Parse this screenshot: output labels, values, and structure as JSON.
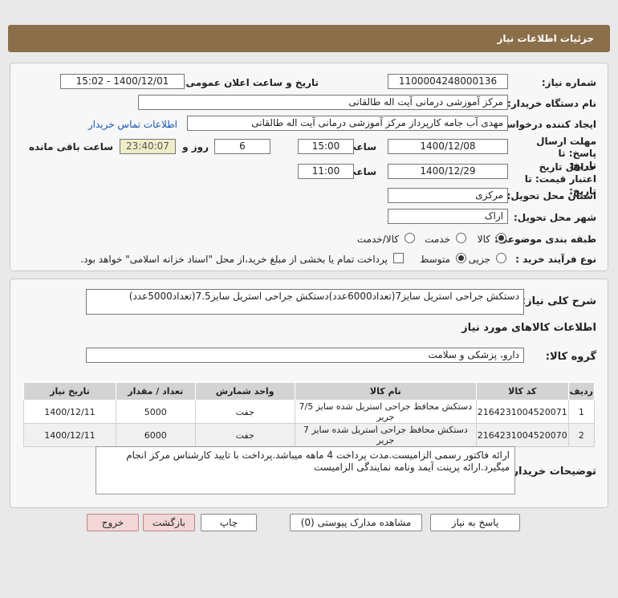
{
  "header": {
    "title": "جزئیات اطلاعات نیاز"
  },
  "form": {
    "need_number": {
      "label": "شماره نیاز:",
      "value": "1100004248000136"
    },
    "announce_datetime": {
      "label": "تاریخ و ساعت اعلان عمومی:",
      "value": "1400/12/01 - 15:02"
    },
    "buyer_org": {
      "label": "نام دستگاه خریدار:",
      "value": "مرکز آموزشی  درمانی آیت اله طالقانی"
    },
    "creator": {
      "label": "ایجاد کننده درخواست:",
      "value": "مهدی آب جامه کارپرداز مرکز آموزشی  درمانی آیت اله طالقانی",
      "contact_link": "اطلاعات تماس خریدار"
    },
    "send_deadline": {
      "label": "مهلت ارسال پاسخ: تا تاریخ:",
      "date": "1400/12/08",
      "time_label": "ساعت",
      "time": "15:00",
      "days": "6",
      "days_label": "روز و",
      "remaining": "23:40:07",
      "remaining_label": "ساعت باقی مانده"
    },
    "price_validity": {
      "label": "حداقل تاریخ اعتبار قیمت: تا تاریخ:",
      "date": "1400/12/29",
      "time_label": "ساعت",
      "time": "11:00"
    },
    "delivery_province": {
      "label": "استان محل تحویل:",
      "value": "مرکزی"
    },
    "delivery_city": {
      "label": "شهر محل تحویل:",
      "value": "اراک"
    },
    "category": {
      "label": "طبقه بندی موضوعی:",
      "options": [
        "کالا",
        "خدمت",
        "کالا/خدمت"
      ],
      "selected": "کالا"
    },
    "purchase_process": {
      "label": "نوع فرآیند خرید :",
      "options": [
        "جزیی",
        "متوسط"
      ],
      "selected": "متوسط",
      "note": "پرداخت تمام یا بخشی از مبلغ خرید،از محل \"اسناد خزانه اسلامی\" خواهد بود."
    }
  },
  "details": {
    "general_desc_label": "شرح کلی نیاز:",
    "general_desc": "دستکش جراحی استریل سایز7(تعداد6000عدد)دستکش جراحی استریل سایز7.5(تعداد5000عدد)",
    "goods_info_title": "اطلاعات کالاهای مورد نیاز",
    "goods_group_label": "گروه کالا:",
    "goods_group": "دارو، پزشکی و سلامت",
    "table": {
      "headers": [
        "ردیف",
        "کد کالا",
        "نام کالا",
        "واحد شمارش",
        "تعداد / مقدار",
        "تاریخ نیاز"
      ],
      "rows": [
        [
          "1",
          "2164231004520071",
          "دستکش محافظ جراحی استریل شده سایز 7/5 جریر",
          "جفت",
          "5000",
          "1400/12/11"
        ],
        [
          "2",
          "2164231004520070",
          "دستکش محافظ جراحی استریل شده سایز 7 جریر",
          "جفت",
          "6000",
          "1400/12/11"
        ]
      ]
    },
    "buyer_notes_label": "توضیحات خریدار:",
    "buyer_notes": "ارائه فاکتور رسمی الزامیست.مدت پرداخت 4 ماهه میباشد.پرداخت با تایید کارشناس مرکز انجام میگیرد.ارائه پرینت آیمد ونامه نمایندگی الزامیست"
  },
  "buttons": {
    "reply": "پاسخ به نیاز",
    "attachments": "مشاهده مدارک پیوستی (0)",
    "print": "چاپ",
    "back": "بازگشت",
    "exit": "خروج"
  }
}
